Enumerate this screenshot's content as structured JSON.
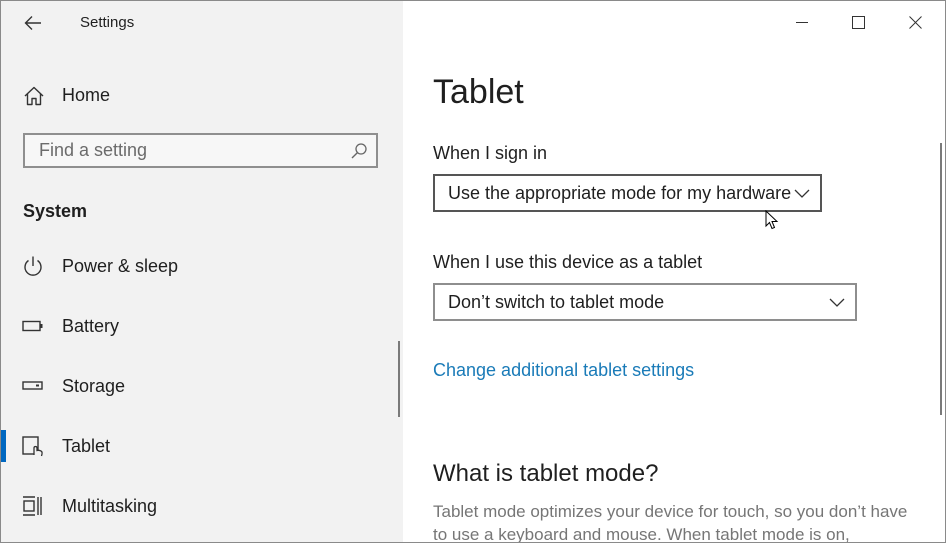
{
  "window": {
    "title": "Settings"
  },
  "sidebar": {
    "home_label": "Home",
    "search": {
      "placeholder": "Find a setting",
      "value": ""
    },
    "section_title": "System",
    "items": [
      {
        "label": "Power & sleep",
        "icon": "power-icon",
        "selected": false
      },
      {
        "label": "Battery",
        "icon": "battery-icon",
        "selected": false
      },
      {
        "label": "Storage",
        "icon": "storage-icon",
        "selected": false
      },
      {
        "label": "Tablet",
        "icon": "tablet-icon",
        "selected": true
      },
      {
        "label": "Multitasking",
        "icon": "multitasking-icon",
        "selected": false
      }
    ]
  },
  "content": {
    "title": "Tablet",
    "sign_in_label": "When I sign in",
    "sign_in_value": "Use the appropriate mode for my hardware",
    "tablet_use_label": "When I use this device as a tablet",
    "tablet_use_value": "Don’t switch to tablet mode",
    "link_label": "Change additional tablet settings",
    "section_heading": "What is tablet mode?",
    "description": "Tablet mode optimizes your device for touch, so you don’t have to use a keyboard and mouse. When tablet mode is on,"
  },
  "colors": {
    "accent": "#0067c0",
    "link": "#1a7bb8",
    "sidebar_bg": "#f2f2f2"
  }
}
